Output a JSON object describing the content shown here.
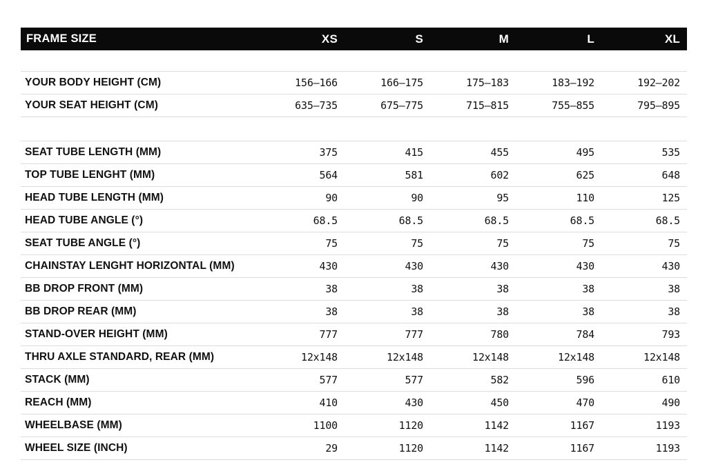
{
  "table": {
    "header": {
      "label": "FRAME SIZE",
      "sizes": [
        "XS",
        "S",
        "M",
        "L",
        "XL"
      ]
    },
    "colors": {
      "header_background": "#0a0a0a",
      "header_text": "#ffffff",
      "row_divider": "#dcdcdc",
      "text": "#111111",
      "page_background": "#ffffff"
    },
    "sections": [
      {
        "name": "rider-fit",
        "rows": [
          {
            "label": "YOUR BODY HEIGHT (CM)",
            "values": [
              "156–166",
              "166–175",
              "175–183",
              "183–192",
              "192–202"
            ]
          },
          {
            "label": "YOUR SEAT HEIGHT (CM)",
            "values": [
              "635–735",
              "675–775",
              "715–815",
              "755–855",
              "795–895"
            ]
          }
        ]
      },
      {
        "name": "frame-geometry",
        "rows": [
          {
            "label": "SEAT TUBE LENGTH (MM)",
            "values": [
              "375",
              "415",
              "455",
              "495",
              "535"
            ]
          },
          {
            "label": "TOP TUBE LENGHT (MM)",
            "values": [
              "564",
              "581",
              "602",
              "625",
              "648"
            ]
          },
          {
            "label": "HEAD TUBE LENGTH (MM)",
            "values": [
              "90",
              "90",
              "95",
              "110",
              "125"
            ]
          },
          {
            "label": "HEAD TUBE ANGLE (°)",
            "values": [
              "68.5",
              "68.5",
              "68.5",
              "68.5",
              "68.5"
            ]
          },
          {
            "label": "SEAT TUBE ANGLE (°)",
            "values": [
              "75",
              "75",
              "75",
              "75",
              "75"
            ]
          },
          {
            "label": "CHAINSTAY LENGHT HORIZONTAL (MM)",
            "values": [
              "430",
              "430",
              "430",
              "430",
              "430"
            ]
          },
          {
            "label": "BB DROP FRONT (MM)",
            "values": [
              "38",
              "38",
              "38",
              "38",
              "38"
            ]
          },
          {
            "label": "BB DROP REAR (MM)",
            "values": [
              "38",
              "38",
              "38",
              "38",
              "38"
            ]
          },
          {
            "label": "STAND-OVER HEIGHT (MM)",
            "values": [
              "777",
              "777",
              "780",
              "784",
              "793"
            ]
          },
          {
            "label": "THRU AXLE STANDARD, REAR (MM)",
            "values": [
              "12x148",
              "12x148",
              "12x148",
              "12x148",
              "12x148"
            ]
          },
          {
            "label": "STACK (MM)",
            "values": [
              "577",
              "577",
              "582",
              "596",
              "610"
            ]
          },
          {
            "label": "REACH (MM)",
            "values": [
              "410",
              "430",
              "450",
              "470",
              "490"
            ]
          },
          {
            "label": "WHEELBASE (MM)",
            "values": [
              "1100",
              "1120",
              "1142",
              "1167",
              "1193"
            ]
          },
          {
            "label": "WHEEL SIZE (INCH)",
            "values": [
              "29",
              "1120",
              "1142",
              "1167",
              "1193"
            ]
          }
        ]
      }
    ]
  }
}
